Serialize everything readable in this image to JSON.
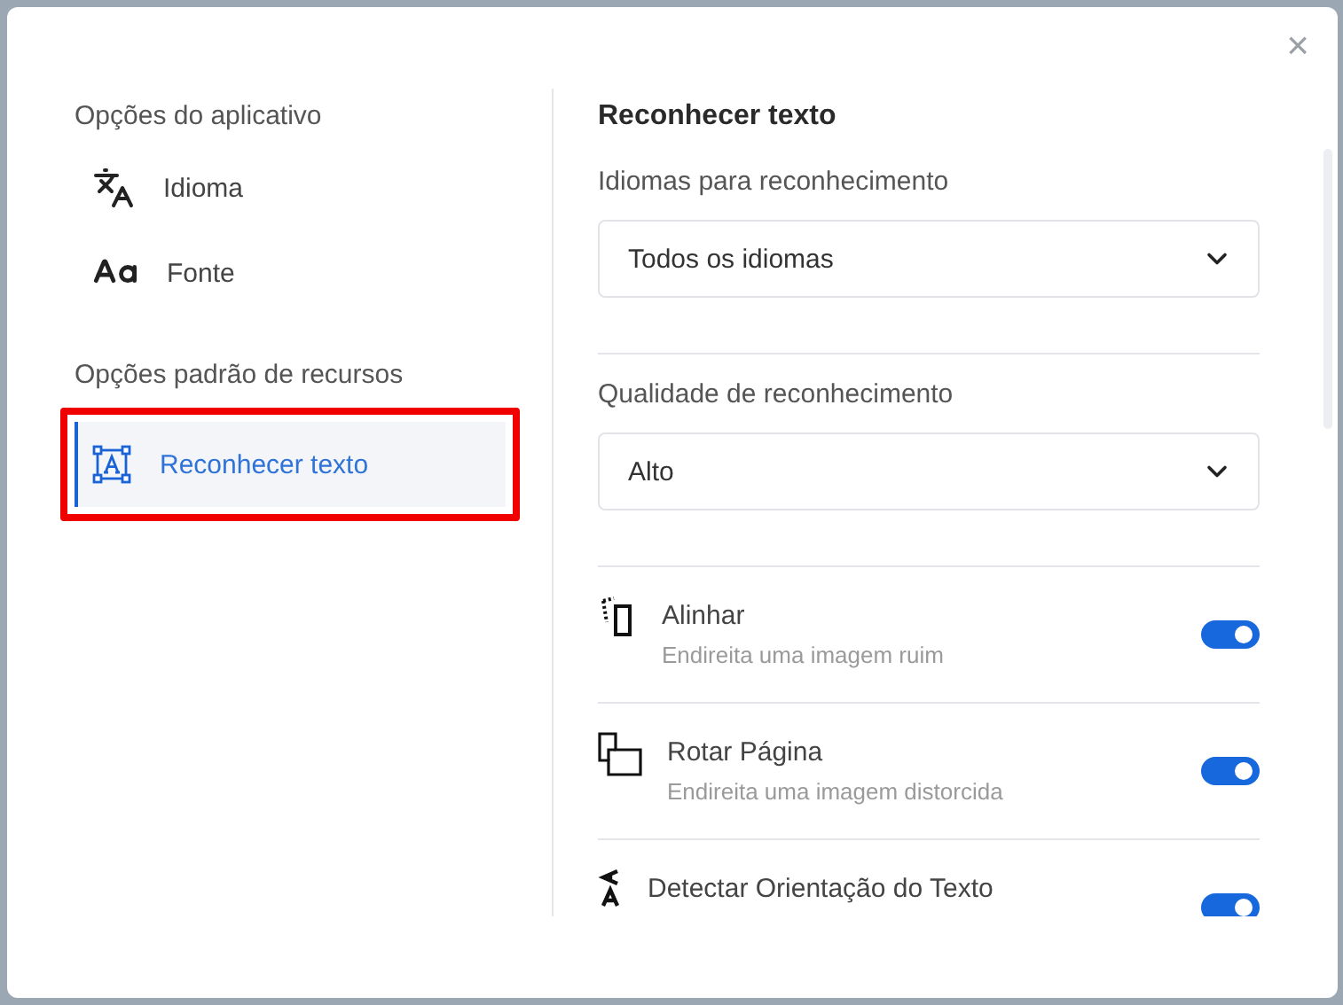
{
  "dialog": {
    "close": "×"
  },
  "sidebar": {
    "sections": [
      {
        "heading": "Opções do aplicativo",
        "items": [
          {
            "label": "Idioma",
            "kind": "language",
            "selected": false,
            "highlighted": false
          },
          {
            "label": "Fonte",
            "kind": "font",
            "selected": false,
            "highlighted": false
          }
        ]
      },
      {
        "heading": "Opções padrão de recursos",
        "items": [
          {
            "label": "Reconhecer texto",
            "kind": "ocr",
            "selected": true,
            "highlighted": true
          }
        ]
      }
    ]
  },
  "panel": {
    "title": "Reconhecer texto",
    "selects": [
      {
        "label": "Idiomas para reconhecimento",
        "value": "Todos os idiomas"
      },
      {
        "label": "Qualidade de reconhecimento",
        "value": "Alto"
      }
    ],
    "toggles": [
      {
        "kind": "deskew",
        "title": "Alinhar",
        "description": "Endireita uma imagem ruim",
        "on": true
      },
      {
        "kind": "rotate",
        "title": "Rotar Página",
        "description": "Endireita uma imagem distorcida",
        "on": true
      },
      {
        "kind": "orientation",
        "title": "Detectar Orientação do Texto",
        "on": true
      }
    ]
  }
}
